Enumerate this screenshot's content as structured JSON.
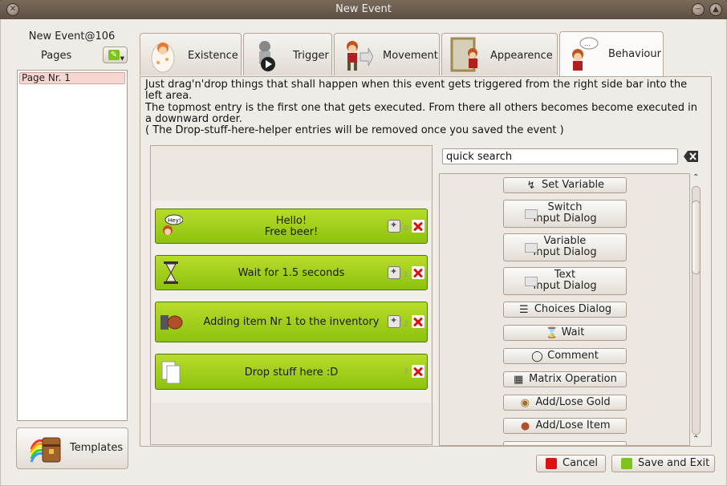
{
  "window": {
    "title": "New Event"
  },
  "left": {
    "event_name": "New Event@106",
    "pages_label": "Pages",
    "pages": [
      "Page Nr. 1"
    ],
    "templates_label": "Templates"
  },
  "tabs": [
    {
      "label": "Existence",
      "icon": "egg-character-icon"
    },
    {
      "label": "Trigger",
      "icon": "play-character-icon"
    },
    {
      "label": "Movement",
      "icon": "walking-character-icon"
    },
    {
      "label": "Appearence",
      "icon": "mirror-character-icon"
    },
    {
      "label": "Behaviour",
      "icon": "thinking-character-icon",
      "active": true
    }
  ],
  "description": {
    "line1": "Just drag'n'drop things that shall happen when this event gets triggered from the right side bar into the left area.",
    "line2": "The topmost entry is the first one that gets executed. From there all others becomes become executed in a downward order.",
    "line3": "( The Drop-stuff-here-helper entries will be removed once you saved the event )"
  },
  "actions": [
    {
      "text_line1": "Hello!",
      "text_line2": "Free beer!",
      "index": "0",
      "icon": "speech-character-icon",
      "bubble": "Hey!"
    },
    {
      "text_line1": "Wait for 1.5 seconds",
      "text_line2": "",
      "index": "1",
      "icon": "hourglass-icon"
    },
    {
      "text_line1": "Adding item Nr 1 to the inventory",
      "text_line2": "",
      "index": "2",
      "icon": "meat-item-icon"
    },
    {
      "text_line1": "Drop stuff here :D",
      "text_line2": "",
      "index": "3",
      "icon": "pages-icon"
    }
  ],
  "search": {
    "value": "quick search"
  },
  "palette": [
    {
      "line1": "Set Variable",
      "line2": "",
      "icon": "variable-icon"
    },
    {
      "line1": "Switch",
      "line2": "Input Dialog",
      "icon": "dialog-icon"
    },
    {
      "line1": "Variable",
      "line2": "Input Dialog",
      "icon": "dialog-icon"
    },
    {
      "line1": "Text",
      "line2": "Input Dialog",
      "icon": "dialog-icon"
    },
    {
      "line1": "Choices Dialog",
      "line2": "",
      "icon": "list-icon"
    },
    {
      "line1": "Wait",
      "line2": "",
      "icon": "hourglass-icon"
    },
    {
      "line1": "Comment",
      "line2": "",
      "icon": "tag-icon"
    },
    {
      "line1": "Matrix Operation",
      "line2": "",
      "icon": "matrix-icon"
    },
    {
      "line1": "Add/Lose Gold",
      "line2": "",
      "icon": "gold-bag-icon"
    },
    {
      "line1": "Add/Lose Item",
      "line2": "",
      "icon": "item-icon"
    }
  ],
  "buttons": {
    "cancel": "Cancel",
    "save": "Save and Exit"
  },
  "colors": {
    "action_green": "#9fcf18",
    "cancel_red": "#d11",
    "save_green": "#7cc41a"
  }
}
